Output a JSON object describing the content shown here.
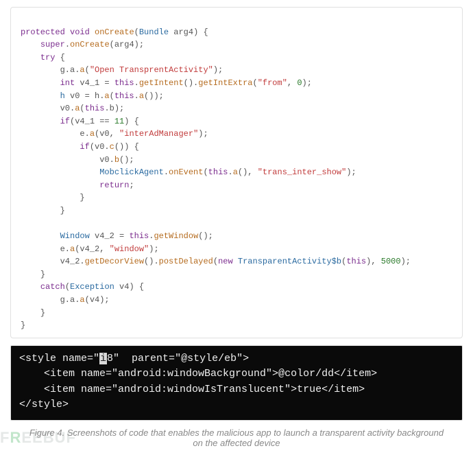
{
  "java_code": {
    "l01_protected": "protected",
    "l01_void": "void",
    "l01_method": "onCreate",
    "l01_p": "(",
    "l01_type": "Bundle",
    "l01_arg": " arg4",
    "l01_cp": ") {",
    "l02_super": "super",
    "l02_dot": ".",
    "l02_method": "onCreate",
    "l02_args": "(arg4);",
    "l03_try": "try",
    "l03_b": " {",
    "l04_obj": "g.a.",
    "l04_method": "a",
    "l04_p": "(",
    "l04_str": "\"Open TransprentActivity\"",
    "l04_cp": ");",
    "l05_int": "int",
    "l05_var": " v4_1 = ",
    "l05_this": "this",
    "l05_dot": ".",
    "l05_m1": "getIntent",
    "l05_p1": "().",
    "l05_m2": "getIntExtra",
    "l05_p2": "(",
    "l05_str": "\"from\"",
    "l05_comma": ", ",
    "l05_num": "0",
    "l05_cp": ");",
    "l06_type": "h",
    "l06_mid": " v0 = h.",
    "l06_method": "a",
    "l06_p": "(",
    "l06_this": "this",
    "l06_dot": ".",
    "l06_m2": "a",
    "l06_cp": "());",
    "l07_pre": "v0.",
    "l07_method": "a",
    "l07_p": "(",
    "l07_this": "this",
    "l07_dot": ".b);",
    "l08_if": "if",
    "l08_cond": "(v4_1 == ",
    "l08_num": "11",
    "l08_cp": ") {",
    "l09_pre": "e.",
    "l09_method": "a",
    "l09_p": "(v0, ",
    "l09_str": "\"interAdManager\"",
    "l09_cp": ");",
    "l10_if": "if",
    "l10_cond": "(v0.",
    "l10_method": "c",
    "l10_cp": "()) {",
    "l11_pre": "v0.",
    "l11_method": "b",
    "l11_cp": "();",
    "l12_type": "MobclickAgent",
    "l12_dot": ".",
    "l12_method": "onEvent",
    "l12_p": "(",
    "l12_this": "this",
    "l12_dot2": ".",
    "l12_m2": "a",
    "l12_mid": "(), ",
    "l12_str": "\"trans_inter_show\"",
    "l12_cp": ");",
    "l13_return": "return",
    "l13_sc": ";",
    "l14_cb": "}",
    "l15_cb": "}",
    "l17_type": "Window",
    "l17_mid": " v4_2 = ",
    "l17_this": "this",
    "l17_dot": ".",
    "l17_method": "getWindow",
    "l17_cp": "();",
    "l18_pre": "e.",
    "l18_method": "a",
    "l18_p": "(v4_2, ",
    "l18_str": "\"window\"",
    "l18_cp": ");",
    "l19_pre": "v4_2.",
    "l19_m1": "getDecorView",
    "l19_mid": "().",
    "l19_m2": "postDelayed",
    "l19_p": "(",
    "l19_new": "new",
    "l19_sp": " ",
    "l19_type": "TransparentActivity$b",
    "l19_p2": "(",
    "l19_this": "this",
    "l19_cp1": "), ",
    "l19_num": "5000",
    "l19_cp2": ");",
    "l20_cb": "}",
    "l21_catch": "catch",
    "l21_p": "(",
    "l21_type": "Exception",
    "l21_arg": " v4) {",
    "l22_pre": "g.a.",
    "l22_method": "a",
    "l22_cp": "(v4);",
    "l23_cb": "}",
    "l24_cb": "}"
  },
  "xml_code": {
    "l1_a": "<style name=\"",
    "l1_hi": "i",
    "l1_b": "8\"  parent=\"@style/eb\">",
    "l2": "    <item name=\"android:windowBackground\">@color/dd</item>",
    "l3": "    <item name=\"android:windowIsTranslucent\">true</item>",
    "l4": "</style>"
  },
  "caption": "Figure 4. Screenshots of code that enables the malicious app to launch a transparent activity background on the affected device",
  "watermark_pre": "F",
  "watermark_g": "R",
  "watermark_post": "EEBUF"
}
